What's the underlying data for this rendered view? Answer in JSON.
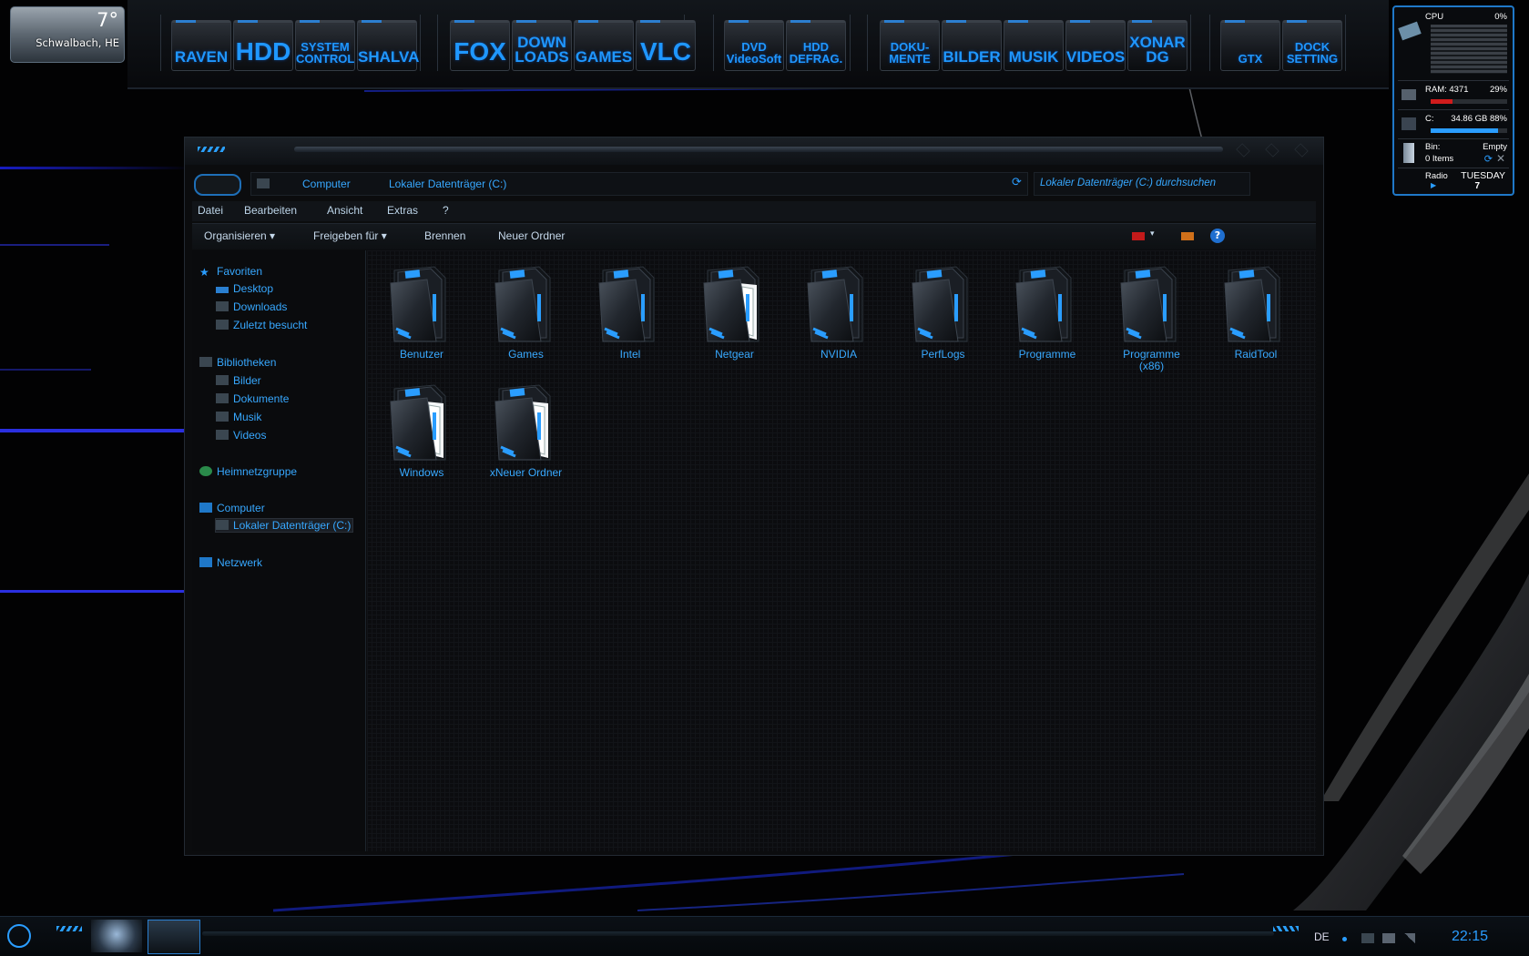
{
  "weather": {
    "temp": "7°",
    "location": "Schwalbach, HE"
  },
  "dock": {
    "items": [
      {
        "label": "RAVEN",
        "size": "med"
      },
      {
        "label": "HDD",
        "size": "big"
      },
      {
        "label": "SYSTEM\nCONTROL",
        "size": "sm"
      },
      {
        "label": "SHALVA",
        "size": "med"
      },
      {
        "label": "FOX",
        "size": "big"
      },
      {
        "label": "DOWN\nLOADS",
        "size": "med"
      },
      {
        "label": "GAMES",
        "size": "med"
      },
      {
        "label": "VLC",
        "size": "big"
      },
      {
        "label": "DVD\nVideoSoft",
        "size": "sm"
      },
      {
        "label": "HDD\nDEFRAG.",
        "size": "sm"
      },
      {
        "label": "DOKU-\nMENTE",
        "size": "sm"
      },
      {
        "label": "BILDER",
        "size": "med"
      },
      {
        "label": "MUSIK",
        "size": "med"
      },
      {
        "label": "VIDEOS",
        "size": "med"
      },
      {
        "label": "XONAR\nDG",
        "size": "med"
      },
      {
        "label": "GTX",
        "size": "sm"
      },
      {
        "label": "DOCK\nSETTING",
        "size": "sm"
      }
    ]
  },
  "gadget": {
    "cpu_label": "CPU",
    "cpu_value": "0%",
    "ram_label": "RAM: 4371",
    "ram_value": "29%",
    "ram_fraction": 0.29,
    "drive_label": "C:",
    "drive_value": "34.86 GB 88%",
    "drive_fraction": 0.88,
    "bin_label": "Bin:",
    "bin_value": "Empty",
    "bin_items": "0 Items",
    "radio_label": "Radio",
    "day": "TUESDAY",
    "date": "7"
  },
  "explorer": {
    "breadcrumb": [
      "Computer",
      "Lokaler Datenträger (C:)"
    ],
    "search_placeholder": "Lokaler Datenträger (C:) durchsuchen",
    "menu": [
      "Datei",
      "Bearbeiten",
      "Ansicht",
      "Extras",
      "?"
    ],
    "toolbar": [
      "Organisieren",
      "Freigeben für",
      "Brennen",
      "Neuer Ordner"
    ],
    "nav": {
      "favorites": "Favoriten",
      "favorite_items": [
        "Desktop",
        "Downloads",
        "Zuletzt besucht"
      ],
      "libraries": "Bibliotheken",
      "library_items": [
        "Bilder",
        "Dokumente",
        "Musik",
        "Videos"
      ],
      "homegroup": "Heimnetzgruppe",
      "computer": "Computer",
      "computer_items": [
        "Lokaler Datenträger (C:)"
      ],
      "network": "Netzwerk"
    },
    "folders": [
      "Benutzer",
      "Games",
      "Intel",
      "Netgear",
      "NVIDIA",
      "PerfLogs",
      "Programme",
      "Programme\n(x86)",
      "RaidTool",
      "Windows",
      "xNeuer Ordner"
    ],
    "folders_with_doc": [
      "Netgear",
      "Windows",
      "xNeuer Ordner"
    ]
  },
  "taskbar": {
    "language": "DE",
    "time": "22:15"
  }
}
